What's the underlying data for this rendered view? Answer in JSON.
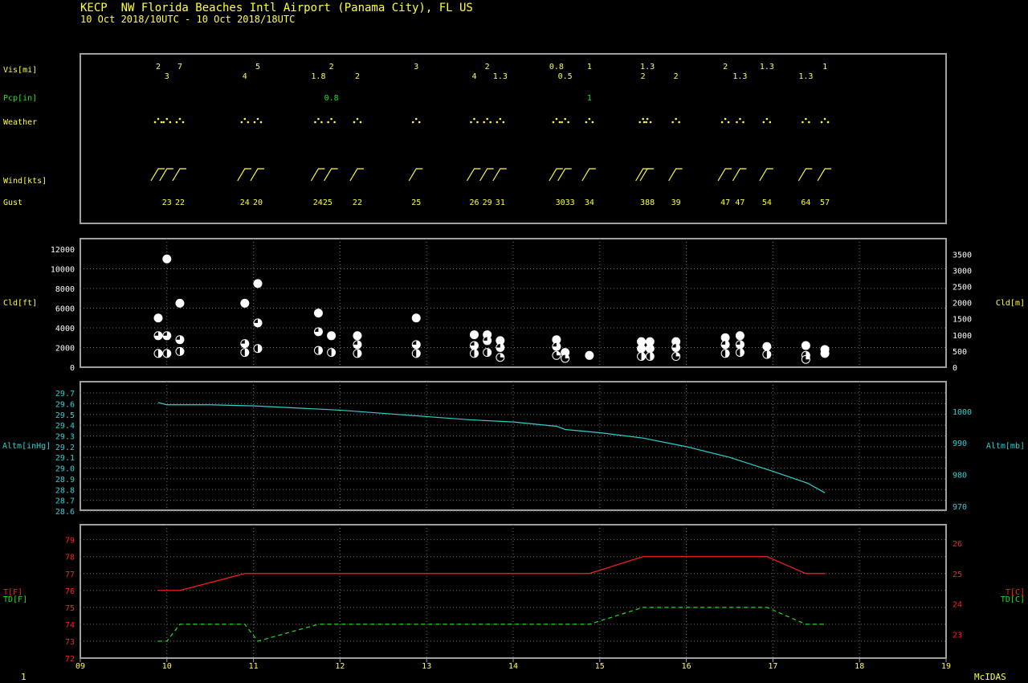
{
  "header": {
    "title": "KECP  NW Florida Beaches Intl Airport (Panama City), FL US",
    "subtitle": "10 Oct 2018/10UTC - 10 Oct 2018/18UTC"
  },
  "footer": {
    "page": "1",
    "brand": "McIDAS"
  },
  "colors": {
    "yellow": "#ffff40",
    "green": "#20e020",
    "cyan": "#30d0d0",
    "red": "#ff2020",
    "white": "#ffffff",
    "frame": "#a0a0a0",
    "grid": "#707070"
  },
  "chart_data": {
    "type": "line",
    "x_axis": {
      "label": "",
      "ticks": [
        "09",
        "10",
        "11",
        "12",
        "13",
        "14",
        "15",
        "16",
        "17",
        "18",
        "19"
      ],
      "range": [
        9,
        19
      ]
    },
    "panels": {
      "obs": {
        "labels": {
          "vis": "Vis[mi]",
          "pcp": "Pcp[in]",
          "weather": "Weather",
          "wind": "Wind[kts]",
          "gust": "Gust"
        },
        "vis": [
          {
            "x": 9.9,
            "v": "2",
            "row": 0
          },
          {
            "x": 10.0,
            "v": "3",
            "row": 1
          },
          {
            "x": 10.15,
            "v": "7",
            "row": 0
          },
          {
            "x": 10.9,
            "v": "4",
            "row": 1
          },
          {
            "x": 11.05,
            "v": "5",
            "row": 0
          },
          {
            "x": 11.75,
            "v": "1.8",
            "row": 1
          },
          {
            "x": 11.9,
            "v": "2",
            "row": 0
          },
          {
            "x": 12.2,
            "v": "2",
            "row": 1
          },
          {
            "x": 12.88,
            "v": "3",
            "row": 0
          },
          {
            "x": 13.55,
            "v": "4",
            "row": 1
          },
          {
            "x": 13.7,
            "v": "2",
            "row": 0
          },
          {
            "x": 13.85,
            "v": "1.3",
            "row": 1
          },
          {
            "x": 14.5,
            "v": "0.8",
            "row": 0
          },
          {
            "x": 14.6,
            "v": "0.5",
            "row": 1
          },
          {
            "x": 14.88,
            "v": "1",
            "row": 0
          },
          {
            "x": 15.5,
            "v": "2",
            "row": 1
          },
          {
            "x": 15.55,
            "v": "1.3",
            "row": 0
          },
          {
            "x": 15.88,
            "v": "2",
            "row": 1
          },
          {
            "x": 16.45,
            "v": "2",
            "row": 0
          },
          {
            "x": 16.62,
            "v": "1.3",
            "row": 1
          },
          {
            "x": 16.93,
            "v": "1.3",
            "row": 0
          },
          {
            "x": 17.38,
            "v": "1.3",
            "row": 1
          },
          {
            "x": 17.6,
            "v": "1",
            "row": 0
          }
        ],
        "pcp": [
          {
            "x": 11.9,
            "v": "0.8"
          },
          {
            "x": 14.88,
            "v": "1"
          }
        ],
        "weather_times": [
          9.9,
          10.0,
          10.15,
          10.9,
          11.05,
          11.75,
          11.9,
          12.2,
          12.88,
          13.55,
          13.7,
          13.85,
          14.5,
          14.6,
          14.88,
          15.5,
          15.55,
          15.88,
          16.45,
          16.62,
          16.93,
          17.38,
          17.6
        ],
        "gust": [
          {
            "x": 10.0,
            "v": "23"
          },
          {
            "x": 10.15,
            "v": "22"
          },
          {
            "x": 10.9,
            "v": "24"
          },
          {
            "x": 11.05,
            "v": "20"
          },
          {
            "x": 11.8,
            "v": "2425"
          },
          {
            "x": 12.2,
            "v": "22"
          },
          {
            "x": 12.88,
            "v": "25"
          },
          {
            "x": 13.55,
            "v": "26"
          },
          {
            "x": 13.7,
            "v": "29"
          },
          {
            "x": 13.85,
            "v": "31"
          },
          {
            "x": 14.6,
            "v": "3033"
          },
          {
            "x": 14.88,
            "v": "34"
          },
          {
            "x": 15.55,
            "v": "388"
          },
          {
            "x": 15.88,
            "v": "39"
          },
          {
            "x": 16.45,
            "v": "47"
          },
          {
            "x": 16.62,
            "v": "47"
          },
          {
            "x": 16.93,
            "v": "54"
          },
          {
            "x": 17.38,
            "v": "64"
          },
          {
            "x": 17.6,
            "v": "57"
          }
        ]
      },
      "cloud": {
        "ylabel_left": "Cld[ft]",
        "ylabel_right": "Cld[m]",
        "ylim_ft": [
          0,
          12000
        ],
        "ticks_ft": [
          "0",
          "2000",
          "4000",
          "6000",
          "8000",
          "10000",
          "12000"
        ],
        "ticks_m": [
          "0",
          "500",
          "1000",
          "1500",
          "2000",
          "2500",
          "3000",
          "3500"
        ],
        "points": [
          {
            "x": 9.9,
            "y": 5000,
            "c": "ovc"
          },
          {
            "x": 9.9,
            "y": 3200,
            "c": "bkn"
          },
          {
            "x": 9.9,
            "y": 1400,
            "c": "sct"
          },
          {
            "x": 10.0,
            "y": 11000,
            "c": "ovc"
          },
          {
            "x": 10.0,
            "y": 3200,
            "c": "bkn"
          },
          {
            "x": 10.0,
            "y": 1400,
            "c": "sct"
          },
          {
            "x": 10.15,
            "y": 6500,
            "c": "ovc"
          },
          {
            "x": 10.15,
            "y": 2800,
            "c": "bkn"
          },
          {
            "x": 10.15,
            "y": 1600,
            "c": "sct"
          },
          {
            "x": 10.9,
            "y": 6500,
            "c": "ovc"
          },
          {
            "x": 10.9,
            "y": 2400,
            "c": "bkn"
          },
          {
            "x": 10.9,
            "y": 1500,
            "c": "sct"
          },
          {
            "x": 11.05,
            "y": 8500,
            "c": "ovc"
          },
          {
            "x": 11.05,
            "y": 4500,
            "c": "bkn"
          },
          {
            "x": 11.05,
            "y": 1900,
            "c": "sct"
          },
          {
            "x": 11.75,
            "y": 5500,
            "c": "ovc"
          },
          {
            "x": 11.75,
            "y": 3600,
            "c": "bkn"
          },
          {
            "x": 11.75,
            "y": 1700,
            "c": "sct"
          },
          {
            "x": 11.9,
            "y": 3200,
            "c": "ovc"
          },
          {
            "x": 11.9,
            "y": 1500,
            "c": "sct"
          },
          {
            "x": 12.2,
            "y": 3200,
            "c": "ovc"
          },
          {
            "x": 12.2,
            "y": 2300,
            "c": "bkn"
          },
          {
            "x": 12.2,
            "y": 1400,
            "c": "sct"
          },
          {
            "x": 12.88,
            "y": 5000,
            "c": "ovc"
          },
          {
            "x": 12.88,
            "y": 2300,
            "c": "bkn"
          },
          {
            "x": 12.88,
            "y": 1400,
            "c": "sct"
          },
          {
            "x": 13.55,
            "y": 3300,
            "c": "ovc"
          },
          {
            "x": 13.55,
            "y": 2200,
            "c": "bkn"
          },
          {
            "x": 13.55,
            "y": 1400,
            "c": "sct"
          },
          {
            "x": 13.7,
            "y": 3300,
            "c": "ovc"
          },
          {
            "x": 13.7,
            "y": 2700,
            "c": "bkn"
          },
          {
            "x": 13.7,
            "y": 1500,
            "c": "sct"
          },
          {
            "x": 13.85,
            "y": 2700,
            "c": "ovc"
          },
          {
            "x": 13.85,
            "y": 2000,
            "c": "bkn"
          },
          {
            "x": 13.85,
            "y": 1000,
            "c": "few"
          },
          {
            "x": 14.5,
            "y": 2800,
            "c": "ovc"
          },
          {
            "x": 14.5,
            "y": 2100,
            "c": "bkn"
          },
          {
            "x": 14.5,
            "y": 1200,
            "c": "few"
          },
          {
            "x": 14.6,
            "y": 1500,
            "c": "ovc"
          },
          {
            "x": 14.6,
            "y": 900,
            "c": "few"
          },
          {
            "x": 14.88,
            "y": 1200,
            "c": "ovc"
          },
          {
            "x": 15.48,
            "y": 2600,
            "c": "ovc"
          },
          {
            "x": 15.48,
            "y": 1900,
            "c": "ovc"
          },
          {
            "x": 15.48,
            "y": 1100,
            "c": "sct"
          },
          {
            "x": 15.58,
            "y": 2600,
            "c": "ovc"
          },
          {
            "x": 15.58,
            "y": 1900,
            "c": "ovc"
          },
          {
            "x": 15.58,
            "y": 1100,
            "c": "sct"
          },
          {
            "x": 15.88,
            "y": 2600,
            "c": "ovc"
          },
          {
            "x": 15.88,
            "y": 2000,
            "c": "bkn"
          },
          {
            "x": 15.88,
            "y": 1100,
            "c": "few"
          },
          {
            "x": 16.45,
            "y": 3000,
            "c": "ovc"
          },
          {
            "x": 16.45,
            "y": 2300,
            "c": "bkn"
          },
          {
            "x": 16.45,
            "y": 1400,
            "c": "sct"
          },
          {
            "x": 16.62,
            "y": 3200,
            "c": "ovc"
          },
          {
            "x": 16.62,
            "y": 2300,
            "c": "bkn"
          },
          {
            "x": 16.62,
            "y": 1500,
            "c": "sct"
          },
          {
            "x": 16.93,
            "y": 2100,
            "c": "ovc"
          },
          {
            "x": 16.93,
            "y": 1300,
            "c": "sct"
          },
          {
            "x": 17.38,
            "y": 2200,
            "c": "ovc"
          },
          {
            "x": 17.38,
            "y": 1200,
            "c": "sct"
          },
          {
            "x": 17.38,
            "y": 800,
            "c": "few"
          },
          {
            "x": 17.6,
            "y": 1800,
            "c": "ovc"
          },
          {
            "x": 17.6,
            "y": 1400,
            "c": "ovc"
          }
        ]
      },
      "altimeter": {
        "ylabel_left": "Altm[inHg]",
        "ylabel_right": "Altm[mb]",
        "ylim": [
          28.6,
          29.8
        ],
        "ticks_in": [
          "28.6",
          "28.7",
          "28.8",
          "28.9",
          "29.0",
          "29.1",
          "29.2",
          "29.3",
          "29.4",
          "29.5",
          "29.6",
          "29.7"
        ],
        "ticks_mb": [
          "970",
          "980",
          "990",
          "1000"
        ],
        "series": [
          {
            "values": [
              [
                9.9,
                29.61
              ],
              [
                10.0,
                29.59
              ],
              [
                10.5,
                29.59
              ],
              [
                11.0,
                29.58
              ],
              [
                11.5,
                29.56
              ],
              [
                12.0,
                29.54
              ],
              [
                12.5,
                29.51
              ],
              [
                13.0,
                29.48
              ],
              [
                13.5,
                29.45
              ],
              [
                14.0,
                29.43
              ],
              [
                14.5,
                29.39
              ],
              [
                14.6,
                29.36
              ],
              [
                15.0,
                29.33
              ],
              [
                15.5,
                29.28
              ],
              [
                16.0,
                29.2
              ],
              [
                16.5,
                29.1
              ],
              [
                17.0,
                28.97
              ],
              [
                17.4,
                28.86
              ],
              [
                17.6,
                28.77
              ]
            ]
          }
        ]
      },
      "temperature": {
        "ylabel_t_f": "T[F]",
        "ylabel_td_f": "TD[F]",
        "ylabel_t_c": "T[C]",
        "ylabel_td_c": "TD[C]",
        "ylim_f": [
          72,
          80
        ],
        "ticks_f": [
          "72",
          "73",
          "74",
          "75",
          "76",
          "77",
          "78",
          "79"
        ],
        "ticks_c": [
          "23",
          "24",
          "25",
          "26"
        ],
        "series": [
          {
            "key": "t",
            "values": [
              [
                9.9,
                76
              ],
              [
                10.15,
                76
              ],
              [
                10.9,
                77
              ],
              [
                14.88,
                77
              ],
              [
                15.5,
                78
              ],
              [
                16.93,
                78
              ],
              [
                17.38,
                77
              ],
              [
                17.6,
                77
              ]
            ]
          },
          {
            "key": "td",
            "values": [
              [
                9.9,
                73
              ],
              [
                10.0,
                73
              ],
              [
                10.15,
                74
              ],
              [
                10.9,
                74
              ],
              [
                11.05,
                73
              ],
              [
                11.75,
                74
              ],
              [
                14.88,
                74
              ],
              [
                15.5,
                75
              ],
              [
                16.93,
                75
              ],
              [
                17.38,
                74
              ],
              [
                17.6,
                74
              ]
            ]
          }
        ]
      }
    }
  }
}
